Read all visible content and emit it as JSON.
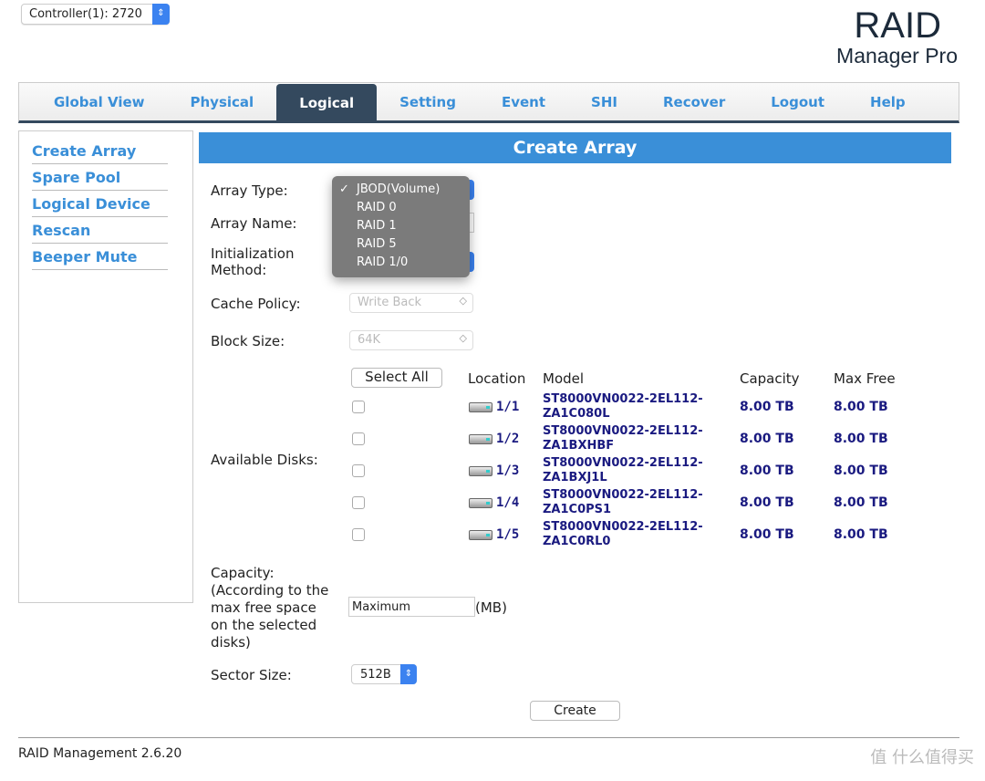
{
  "controller": {
    "value": "Controller(1): 2720"
  },
  "logo": {
    "line1": "RAID",
    "line2": "Manager Pro"
  },
  "nav": [
    {
      "label": "Global View"
    },
    {
      "label": "Physical"
    },
    {
      "label": "Logical",
      "active": true
    },
    {
      "label": "Setting"
    },
    {
      "label": "Event"
    },
    {
      "label": "SHI"
    },
    {
      "label": "Recover"
    },
    {
      "label": "Logout"
    },
    {
      "label": "Help"
    }
  ],
  "sidebar": [
    "Create Array",
    "Spare Pool",
    "Logical Device",
    "Rescan",
    "Beeper Mute"
  ],
  "header": "Create Array",
  "form": {
    "array_type_label": "Array Type:",
    "array_type_options": [
      "JBOD(Volume)",
      "RAID 0",
      "RAID 1",
      "RAID 5",
      "RAID 1/0"
    ],
    "array_type_selected": "JBOD(Volume)",
    "array_name_label": "Array Name:",
    "init_label_1": "Initialization",
    "init_label_2": "Method:",
    "cache_label": "Cache Policy:",
    "cache_value": "Write Back",
    "block_label": "Block Size:",
    "block_value": "64K",
    "disks_label": "Available Disks:",
    "select_all": "Select All",
    "columns": [
      "Location",
      "Model",
      "Capacity",
      "Max Free"
    ],
    "disks": [
      {
        "loc": "1/1",
        "model1": "ST8000VN0022-2EL112-",
        "model2": "ZA1C080L",
        "cap": "8.00 TB",
        "free": "8.00 TB"
      },
      {
        "loc": "1/2",
        "model1": "ST8000VN0022-2EL112-",
        "model2": "ZA1BXHBF",
        "cap": "8.00 TB",
        "free": "8.00 TB"
      },
      {
        "loc": "1/3",
        "model1": "ST8000VN0022-2EL112-",
        "model2": "ZA1BXJ1L",
        "cap": "8.00 TB",
        "free": "8.00 TB"
      },
      {
        "loc": "1/4",
        "model1": "ST8000VN0022-2EL112-",
        "model2": "ZA1C0PS1",
        "cap": "8.00 TB",
        "free": "8.00 TB"
      },
      {
        "loc": "1/5",
        "model1": "ST8000VN0022-2EL112-",
        "model2": "ZA1C0RL0",
        "cap": "8.00 TB",
        "free": "8.00 TB"
      }
    ],
    "capacity_lines": [
      "Capacity:",
      "(According to the",
      "max free space",
      "on the selected",
      "disks)"
    ],
    "capacity_value": "Maximum",
    "capacity_unit": "(MB)",
    "sector_label": "Sector Size:",
    "sector_value": "512B",
    "create": "Create"
  },
  "footer": "RAID Management 2.6.20",
  "watermark": "值 什么值得买",
  "colors": {
    "accent": "#3a8fd8",
    "nav_active": "#34495e",
    "disk_text": "#1a1a80"
  }
}
